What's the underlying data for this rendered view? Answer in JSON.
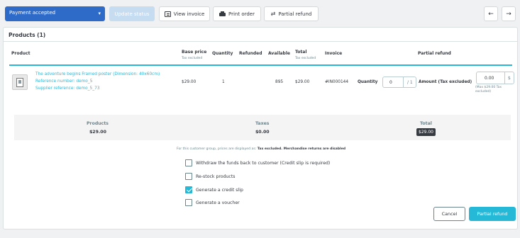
{
  "toolbar": {
    "status_value": "Payment accepted",
    "update_status": "Update status",
    "view_invoice": "View invoice",
    "print_order": "Print order",
    "partial_refund": "Partial refund",
    "prev_arrow": "←",
    "next_arrow": "→"
  },
  "products": {
    "title": "Products (1)",
    "columns": {
      "product": "Product",
      "base_price": "Base price",
      "base_price_sub": "Tax excluded",
      "quantity": "Quantity",
      "refunded": "Refunded",
      "available": "Available",
      "total": "Total",
      "total_sub": "Tax excluded",
      "invoice": "Invoice",
      "partial_refund": "Partial refund"
    },
    "row": {
      "name": "The adventure begins Framed poster (Dimension: 40x60cm)",
      "reference": "Reference number: demo_5",
      "supplier_ref": "Supplier reference: demo_5_73",
      "base_price": "$29.00",
      "quantity": "1",
      "refunded": "",
      "available": "895",
      "total": "$29.00",
      "invoice": "#IN000144",
      "refund_qty_label": "Quantity",
      "refund_qty_value": "0",
      "refund_qty_max": "/ 1",
      "amount_label": "Amount (Tax excluded)",
      "amount_value": "0.00",
      "amount_currency": "$",
      "amount_note": "(Max $29.00 Tax excluded)"
    }
  },
  "summary": {
    "products_label": "Products",
    "products_value": "$29.00",
    "taxes_label": "Taxes",
    "taxes_value": "$0.00",
    "total_label": "Total",
    "total_value": "$29.00"
  },
  "info": {
    "prefix": "For this customer group, prices are displayed as: ",
    "tax_mode": "Tax excluded",
    "suffix": ". Merchandise returns are disabled"
  },
  "options": [
    {
      "label": "Withdraw the funds back to customer (Credit slip is required)",
      "checked": false
    },
    {
      "label": "Re-stock products",
      "checked": false
    },
    {
      "label": "Generate a credit slip",
      "checked": true
    },
    {
      "label": "Generate a voucher",
      "checked": false
    }
  ],
  "actions": {
    "cancel": "Cancel",
    "submit": "Partial refund"
  },
  "colors": {
    "accent": "#25b9d7",
    "status_blue": "#2e6bc8"
  }
}
